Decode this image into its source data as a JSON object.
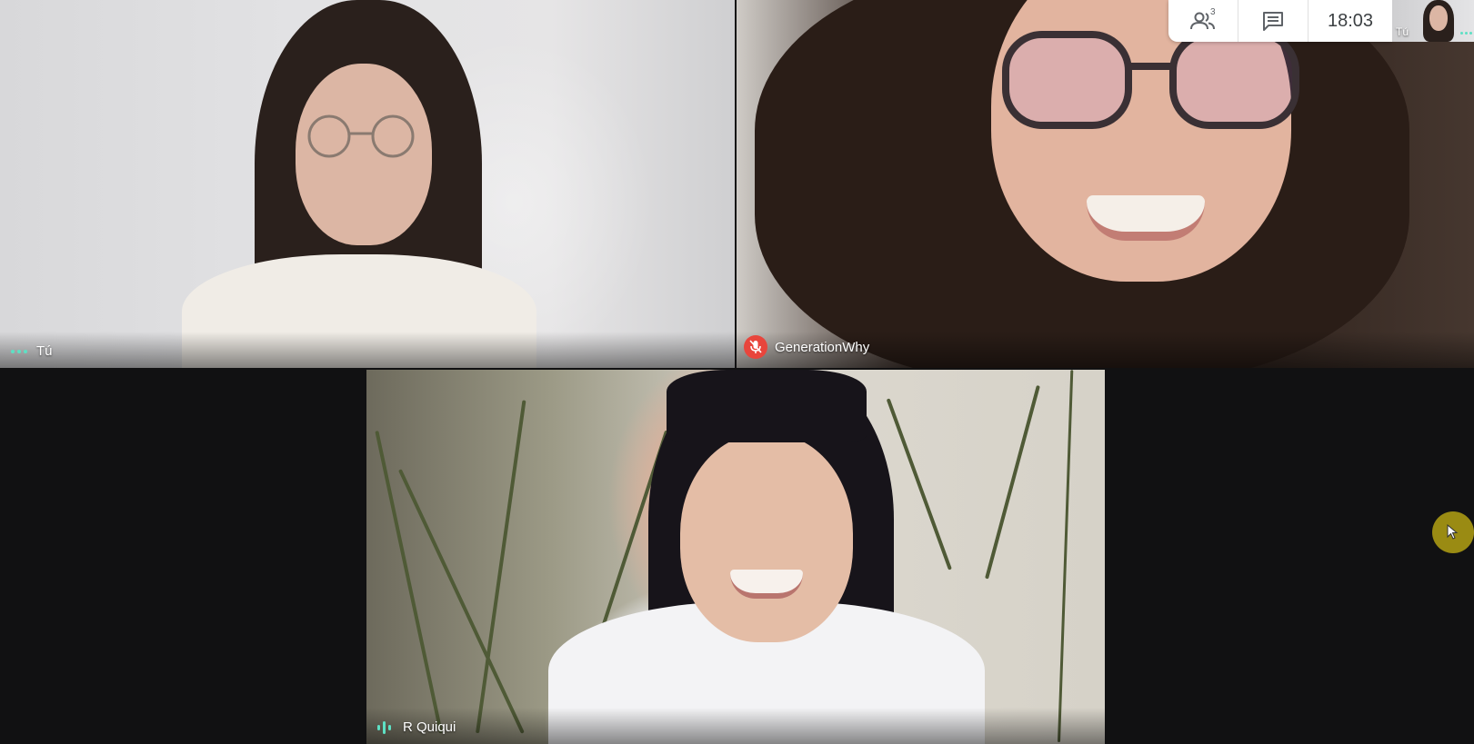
{
  "meeting": {
    "clock": "18:03",
    "people_count": "3"
  },
  "tiles": [
    {
      "name": "Tú",
      "status_icon": "more-dots-icon"
    },
    {
      "name": "GenerationWhy",
      "status_icon": "mic-off-icon"
    },
    {
      "name": "R Quiqui",
      "status_icon": "speaking-icon"
    }
  ],
  "self_view": {
    "label": "Tú",
    "status_icon": "more-dots-icon"
  },
  "toolbar": {
    "people_icon": "people-icon",
    "chat_icon": "chat-icon"
  },
  "colors": {
    "accent_teal": "#5ee0c4",
    "mic_off_red": "#e8453c",
    "cursor_highlight": "#c8b414",
    "background": "#111112"
  }
}
